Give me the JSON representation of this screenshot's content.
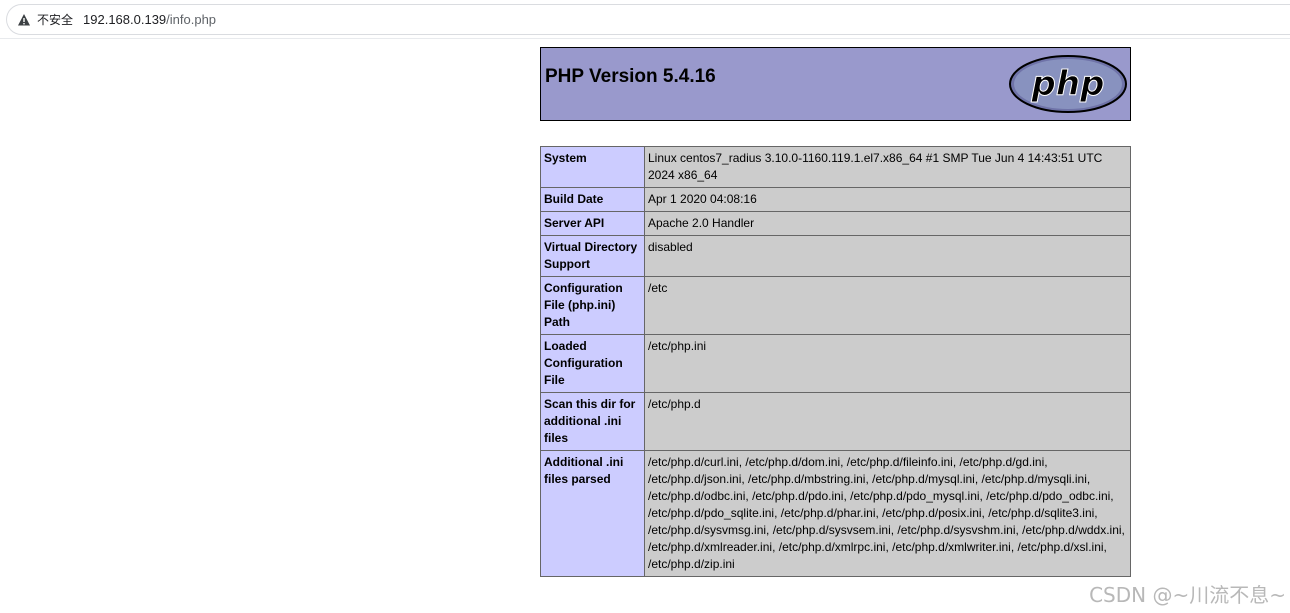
{
  "browser": {
    "security_label": "不安全",
    "url_host": "192.168.0.139",
    "url_path": "/info.php"
  },
  "header": {
    "title": "PHP Version 5.4.16",
    "logo_text": "php"
  },
  "rows": [
    {
      "key": "System",
      "value": "Linux centos7_radius 3.10.0-1160.119.1.el7.x86_64 #1 SMP Tue Jun 4 14:43:51 UTC 2024 x86_64"
    },
    {
      "key": "Build Date",
      "value": "Apr 1 2020 04:08:16"
    },
    {
      "key": "Server API",
      "value": "Apache 2.0 Handler"
    },
    {
      "key": "Virtual Directory Support",
      "value": "disabled"
    },
    {
      "key": "Configuration File (php.ini) Path",
      "value": "/etc"
    },
    {
      "key": "Loaded Configuration File",
      "value": "/etc/php.ini"
    },
    {
      "key": "Scan this dir for additional .ini files",
      "value": "/etc/php.d"
    },
    {
      "key": "Additional .ini files parsed",
      "value": "/etc/php.d/curl.ini, /etc/php.d/dom.ini, /etc/php.d/fileinfo.ini, /etc/php.d/gd.ini, /etc/php.d/json.ini, /etc/php.d/mbstring.ini, /etc/php.d/mysql.ini, /etc/php.d/mysqli.ini, /etc/php.d/odbc.ini, /etc/php.d/pdo.ini, /etc/php.d/pdo_mysql.ini, /etc/php.d/pdo_odbc.ini, /etc/php.d/pdo_sqlite.ini, /etc/php.d/phar.ini, /etc/php.d/posix.ini, /etc/php.d/sqlite3.ini, /etc/php.d/sysvmsg.ini, /etc/php.d/sysvsem.ini, /etc/php.d/sysvshm.ini, /etc/php.d/wddx.ini, /etc/php.d/xmlreader.ini, /etc/php.d/xmlrpc.ini, /etc/php.d/xmlwriter.ini, /etc/php.d/xsl.ini, /etc/php.d/zip.ini"
    }
  ],
  "watermark": "CSDN @~川流不息~",
  "icons": {
    "security": "warning-triangle-icon",
    "logo": "php-logo"
  },
  "colors": {
    "header_bg": "#9999cc",
    "key_bg": "#ccccff",
    "value_bg": "#cccccc"
  }
}
